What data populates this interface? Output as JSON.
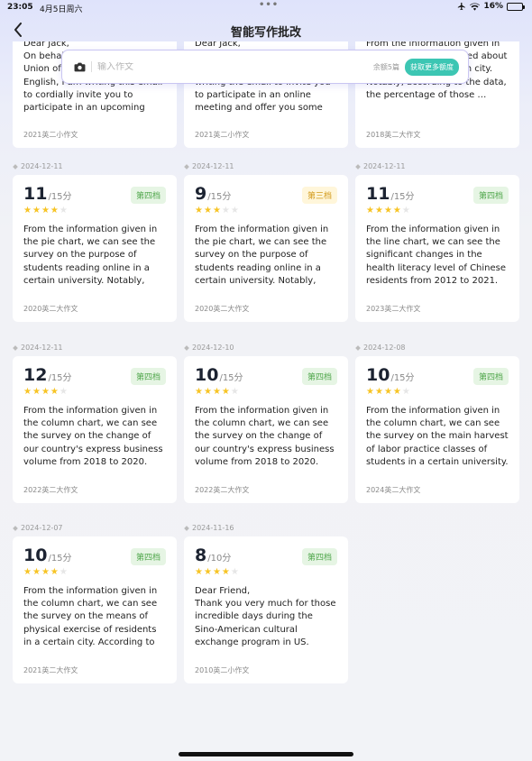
{
  "status": {
    "time": "23:05",
    "date": "4月5日周六",
    "dots": "•••",
    "battery": "16%",
    "battery_level": 0.16
  },
  "header": {
    "title": "智能写作批改"
  },
  "search": {
    "placeholder": "输入作文",
    "remaining": "余额5篇",
    "more_button": "获取更多额度"
  },
  "top_cards": [
    {
      "text": "Dear Jack,\nOn behalf of the Students' Union of the Department of English, I am writing this email to cordially invite you to participate in an upcoming online meeting and offer you som…",
      "tag": "2021英二小作文"
    },
    {
      "text": "Dear Jack,\nOn behalf of the Students' Union of our department, I am writing the email to invite you to participate in an online meeting and offer you some information about…",
      "tag": "2021英二小作文"
    },
    {
      "text": "From the information given in the survey on concerned about restaurants in a certain city. Notably, according to the data, the percentage of those …",
      "tag": "2018英二大作文"
    }
  ],
  "cards": [
    {
      "date": "2024-12-11",
      "score": "11",
      "total": "/15分",
      "level": "第四档",
      "level_color": "green",
      "stars": 4,
      "text": "From the information given in the pie chart, we can see the survey on the purpose of students reading online in a certain university. Notably, according to the data, the percentage of those who read in …",
      "tag": "2020英二大作文"
    },
    {
      "date": "2024-12-11",
      "score": "9",
      "total": "/15分",
      "level": "第三档",
      "level_color": "yellow",
      "stars": 3,
      "text": "From the information given in the pie chart, we can see the survey on the purpose of students reading online in a certain university. Notably, according to the data, the percentage of those who in order…",
      "tag": "2020英二大作文"
    },
    {
      "date": "2024-12-11",
      "score": "11",
      "total": "/15分",
      "level": "第四档",
      "level_color": "green",
      "stars": 4,
      "text": "From the information given in the line chart, we can see the significant changes in the health literacy level of Chinese residents from 2012 to 2021. Over the observed period, the percentage …",
      "tag": "2023英二大作文"
    },
    {
      "date": "2024-12-11",
      "score": "12",
      "total": "/15分",
      "level": "第四档",
      "level_color": "green",
      "stars": 4,
      "text": "From the information given in the column chart, we can see the survey on the change of our country's express business volume from 2018 to 2020. During this period, the total number of our …",
      "tag": "2022英二大作文"
    },
    {
      "date": "2024-12-10",
      "score": "10",
      "total": "/15分",
      "level": "第四档",
      "level_color": "green",
      "stars": 4,
      "text": "From the information given in the column chart, we can see the survey on the change of our country's express business volume from 2018 to 2020. During this period, the total number of our …",
      "tag": "2022英二大作文"
    },
    {
      "date": "2024-12-08",
      "score": "10",
      "total": "/15分",
      "level": "第四档",
      "level_color": "green",
      "stars": 4,
      "text": "From the information given in the column chart, we can see the survey on the main harvest of labor practice classes of students in a certain university. Notably, according to the data, the …",
      "tag": "2024英二大作文"
    },
    {
      "date": "2024-12-07",
      "score": "10",
      "total": "/15分",
      "level": "第四档",
      "level_color": "green",
      "stars": 4,
      "text": "From the information given in the column chart, we can see the survey on the means of physical exercise of residents in a certain city. According to the date, the percentage of doing exercise alo…",
      "tag": "2021英二大作文"
    },
    {
      "date": "2024-11-16",
      "score": "8",
      "total": "/10分",
      "level": "第四档",
      "level_color": "green",
      "stars": 4,
      "text": "Dear Friend,\n      Thank you very much for those incredible days during the Sino-American cultural exchange program in US. Every moment was a delight. I can't remember ever …",
      "tag": "2010英二小作文"
    }
  ],
  "colors": {
    "accent": "#3cc6b3",
    "level_green_bg": "#e6f5e4",
    "level_green_text": "#4ea64a",
    "level_yellow_bg": "#fff6da",
    "level_yellow_text": "#d29a1a",
    "star": "#f7c425"
  }
}
